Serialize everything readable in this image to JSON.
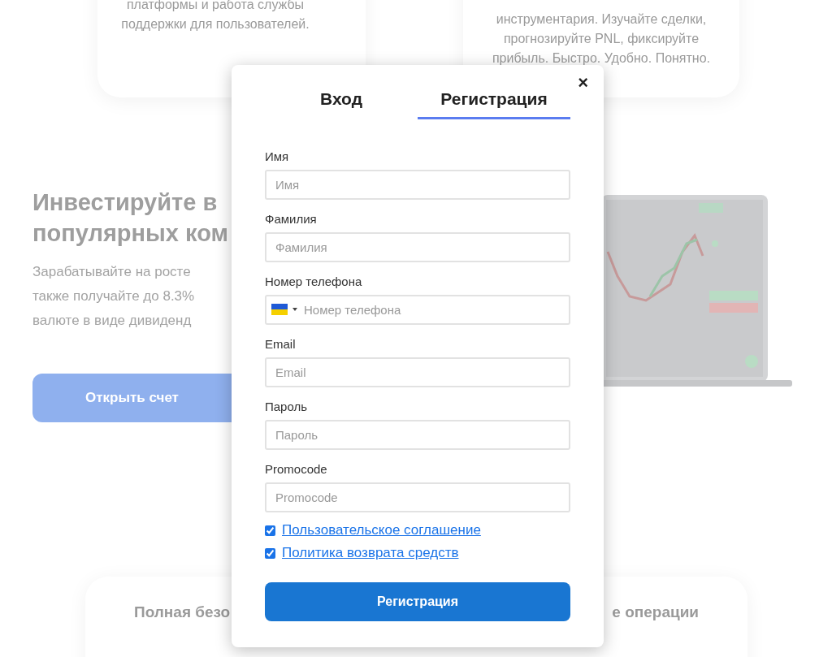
{
  "background": {
    "cards": [
      {
        "lines": [
          "платформы и работа службы",
          "поддержки для пользователей."
        ]
      },
      {
        "lines": [
          "инструментария. Изучайте сделки,",
          "прогнозируйте PNL, фиксируйте",
          "прибыль. Быстро. Удобно. Понятно."
        ]
      }
    ],
    "hero": {
      "title_lines": [
        "Инвестируйте в",
        "популярных ком"
      ],
      "text_lines": [
        "Зарабатывайте на росте",
        "также получайте до 8.3%",
        "валюте в виде дивиденд"
      ],
      "button": "Открыть счет"
    },
    "bottom_card": {
      "texts": [
        "Полная безо",
        "е операции"
      ]
    }
  },
  "modal": {
    "tabs": [
      {
        "label": "Вход",
        "selected": false
      },
      {
        "label": "Регистрация",
        "selected": true
      }
    ],
    "close": "×",
    "fields": [
      {
        "kind": "text",
        "label": "Имя",
        "placeholder": "Имя"
      },
      {
        "kind": "text",
        "label": "Фамилия",
        "placeholder": "Фамилия"
      },
      {
        "kind": "phone",
        "label": "Номер телефона",
        "placeholder": "Номер телефона"
      },
      {
        "kind": "text",
        "label": "Email",
        "placeholder": "Email"
      },
      {
        "kind": "password",
        "label": "Пароль",
        "placeholder": "Пароль"
      },
      {
        "kind": "text",
        "label": "Promocode",
        "placeholder": "Promocode"
      }
    ],
    "agreements": [
      {
        "label": "Пользовательское соглашение",
        "checked": true
      },
      {
        "label": "Политика возврата средств",
        "checked": true
      }
    ],
    "submit": "Регистрация"
  }
}
